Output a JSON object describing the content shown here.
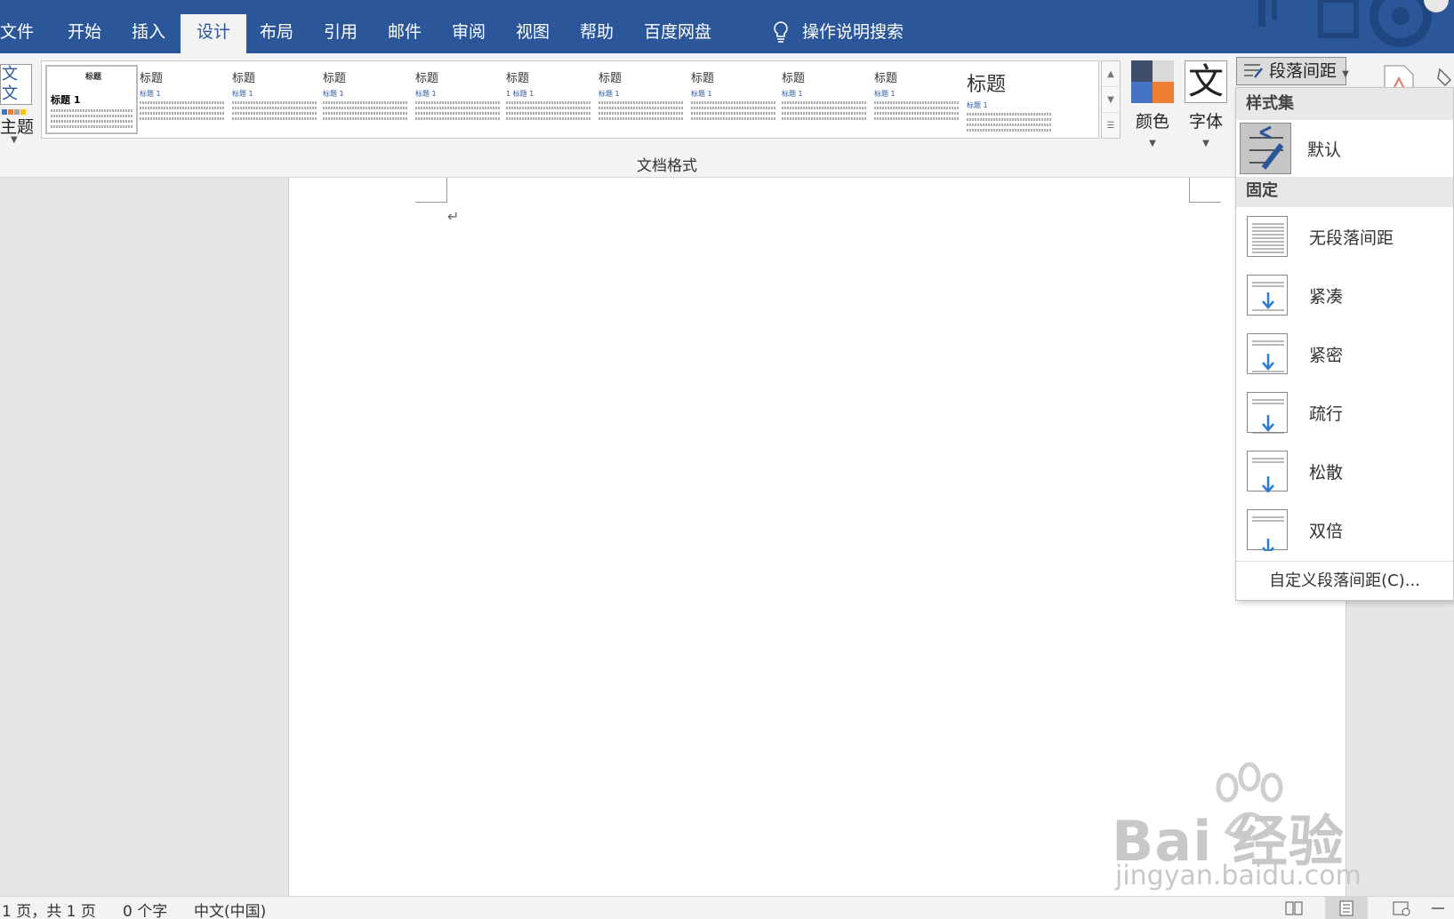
{
  "tabs": [
    {
      "label": "文件",
      "active": false
    },
    {
      "label": "开始",
      "active": false
    },
    {
      "label": "插入",
      "active": false
    },
    {
      "label": "设计",
      "active": true
    },
    {
      "label": "布局",
      "active": false
    },
    {
      "label": "引用",
      "active": false
    },
    {
      "label": "邮件",
      "active": false
    },
    {
      "label": "审阅",
      "active": false
    },
    {
      "label": "视图",
      "active": false
    },
    {
      "label": "帮助",
      "active": false
    },
    {
      "label": "百度网盘",
      "active": false
    }
  ],
  "tell_me": {
    "label": "操作说明搜索",
    "icon": "lightbulb-icon"
  },
  "ribbon": {
    "themes_label": "主题",
    "themes_icon_text": "文文",
    "gallery": [
      {
        "title": "标题",
        "heading": "标题 1"
      },
      {
        "title": "标题",
        "heading": "标题 1"
      },
      {
        "title": "标题",
        "heading": "标题 1"
      },
      {
        "title": "标题",
        "heading": "标题 1"
      },
      {
        "title": "标题",
        "heading": "标题 1"
      },
      {
        "title": "标题",
        "heading": "1 标题 1"
      },
      {
        "title": "标题",
        "heading": "标题 1"
      },
      {
        "title": "标题",
        "heading": "标题 1"
      },
      {
        "title": "标题",
        "heading": "标题 1"
      },
      {
        "title": "标题",
        "heading": "标题 1"
      },
      {
        "title": "标题",
        "heading": "标题 1"
      }
    ],
    "colors_label": "颜色",
    "fonts_label": "字体",
    "fonts_icon_text": "文",
    "paragraph_spacing_label": "段落间距",
    "group_name": "文档格式",
    "colors": [
      "#3f4f6b",
      "#d9d9d9",
      "#4472c4",
      "#ed7d31"
    ]
  },
  "dropdown": {
    "section_style_set": "样式集",
    "default_label": "默认",
    "section_fixed": "固定",
    "items": [
      {
        "label": "无段落间距",
        "icon": "no-spacing-icon"
      },
      {
        "label": "紧凑",
        "icon": "compact-icon"
      },
      {
        "label": "紧密",
        "icon": "tight-icon"
      },
      {
        "label": "疏行",
        "icon": "open-icon"
      },
      {
        "label": "松散",
        "icon": "relaxed-icon"
      },
      {
        "label": "双倍",
        "icon": "double-icon"
      }
    ],
    "custom_label": "自定义段落间距(C)..."
  },
  "document": {
    "paragraph_mark": "↵"
  },
  "status": {
    "page": "1 页，共 1 页",
    "words": "0 个字",
    "language": "中文(中国)"
  },
  "watermark": {
    "big": "Bai 经验",
    "small": "jingyan.baidu.com"
  }
}
